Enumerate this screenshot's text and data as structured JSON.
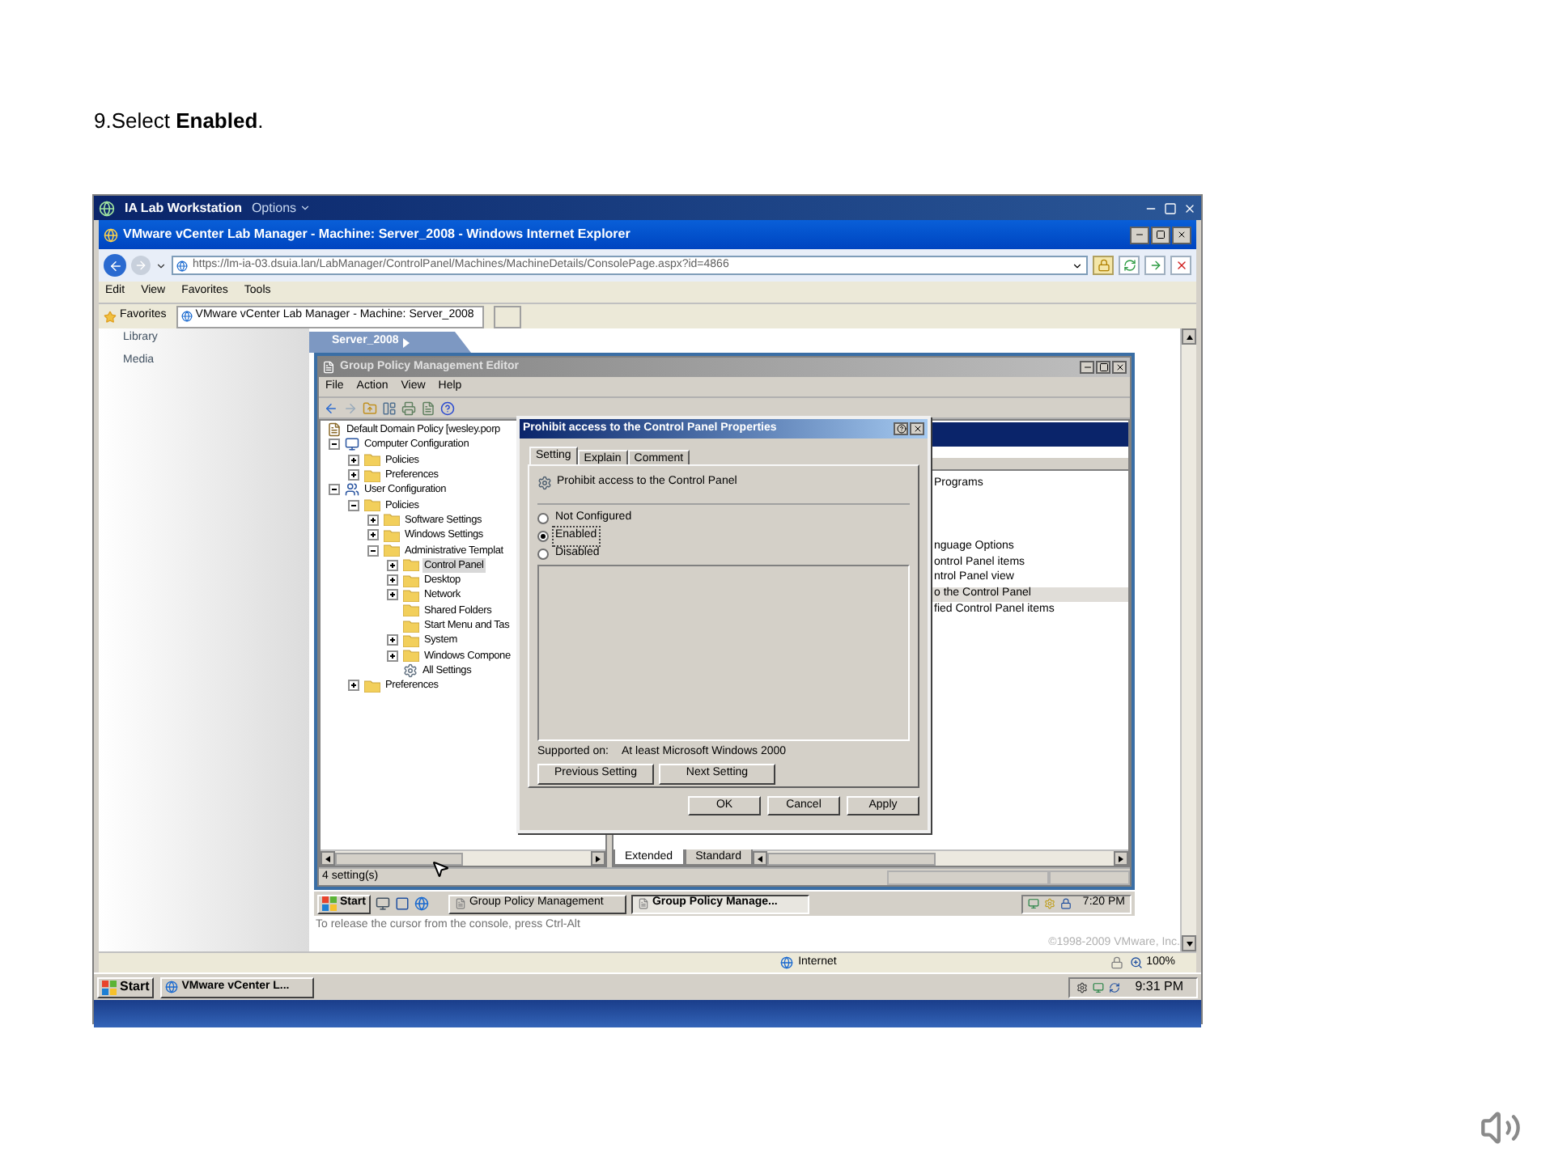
{
  "slide": {
    "instruction": "9.Select **Enabled**."
  },
  "host": {
    "title": "IA Lab Workstation",
    "options": "Options",
    "clock": "9:31 PM",
    "start": "Start",
    "task": "VMware vCenter L..."
  },
  "browser": {
    "title": "VMware vCenter Lab Manager - Machine: Server_2008 - Windows Internet Explorer",
    "address": "https://lm-ia-03.dsuia.lan/LabManager/ControlPanel/Machines/MachineDetails/ConsolePage.aspx?id=4866",
    "menu": [
      "Edit",
      "View",
      "Favorites",
      "Tools"
    ],
    "favorites": "Favorites",
    "tab": "VMware vCenter Lab Manager - Machine: Server_2008",
    "sidebar": [
      "Library",
      "Media"
    ],
    "machine_tab": "Server_2008",
    "console_hint": "To release the cursor from the console, press Ctrl-Alt",
    "copyright": "©1998-2009 VMware, Inc.",
    "status_zone": "Internet",
    "zoom": "100%"
  },
  "editor": {
    "title": "Group Policy Management Editor",
    "menu": [
      "File",
      "Action",
      "View",
      "Help"
    ],
    "tree": [
      {
        "label": "Default Domain Policy [wesley.porp",
        "kind": "policy",
        "selected": false,
        "children": [
          {
            "label": "Computer Configuration",
            "kind": "computer",
            "expanded": true,
            "selected": false,
            "children": [
              {
                "label": "Policies",
                "kind": "folder",
                "expanded": false,
                "selected": false
              },
              {
                "label": "Preferences",
                "kind": "folder",
                "expanded": false,
                "selected": false
              }
            ]
          },
          {
            "label": "User Configuration",
            "kind": "user",
            "expanded": true,
            "selected": false,
            "children": [
              {
                "label": "Policies",
                "kind": "folder",
                "expanded": true,
                "selected": false,
                "children": [
                  {
                    "label": "Software Settings",
                    "kind": "folder",
                    "expanded": false,
                    "selected": false
                  },
                  {
                    "label": "Windows Settings",
                    "kind": "folder",
                    "expanded": false,
                    "selected": false
                  },
                  {
                    "label": "Administrative Templat",
                    "kind": "folder",
                    "expanded": true,
                    "selected": false,
                    "children": [
                      {
                        "label": "Control Panel",
                        "kind": "folder",
                        "expanded": false,
                        "selected": true
                      },
                      {
                        "label": "Desktop",
                        "kind": "folder",
                        "expanded": false,
                        "selected": false
                      },
                      {
                        "label": "Network",
                        "kind": "folder",
                        "expanded": false,
                        "selected": false
                      },
                      {
                        "label": "Shared Folders",
                        "kind": "folder",
                        "selected": false
                      },
                      {
                        "label": "Start Menu and Tas",
                        "kind": "folder",
                        "selected": false
                      },
                      {
                        "label": "System",
                        "kind": "folder",
                        "expanded": false,
                        "selected": false
                      },
                      {
                        "label": "Windows Compone",
                        "kind": "folder",
                        "expanded": false,
                        "selected": false
                      },
                      {
                        "label": "All Settings",
                        "kind": "settings",
                        "selected": false
                      }
                    ]
                  }
                ]
              },
              {
                "label": "Preferences",
                "kind": "folder",
                "expanded": false,
                "selected": false
              }
            ]
          }
        ]
      }
    ],
    "rows": [
      {
        "kind": "text",
        "text": "Programs",
        "selected": false
      },
      {
        "kind": "hidden"
      },
      {
        "kind": "hidden"
      },
      {
        "kind": "hidden"
      },
      {
        "kind": "text",
        "text": "nguage Options",
        "selected": false
      },
      {
        "kind": "text",
        "text": "ontrol Panel items",
        "selected": false
      },
      {
        "kind": "text",
        "text": "ntrol Panel view",
        "selected": false
      },
      {
        "kind": "text",
        "text": "o the Control Panel",
        "selected": true
      },
      {
        "kind": "text",
        "text": "fied Control Panel items",
        "selected": false
      }
    ],
    "view_tabs": [
      {
        "label": "Extended",
        "selected": true
      },
      {
        "label": "Standard",
        "selected": false
      }
    ],
    "status": "4 setting(s)"
  },
  "dialog": {
    "title": "Prohibit access to the Control Panel Properties",
    "tabs": [
      {
        "label": "Setting",
        "selected": true
      },
      {
        "label": "Explain",
        "selected": false
      },
      {
        "label": "Comment",
        "selected": false
      }
    ],
    "setting": "Prohibit access to the Control Panel",
    "options": [
      {
        "label": "Not Configured",
        "selected": false
      },
      {
        "label": "Enabled",
        "selected": true
      },
      {
        "label": "Disabled",
        "selected": false
      }
    ],
    "supported_label": "Supported on:",
    "supported": "At least Microsoft Windows 2000",
    "nav_buttons": [
      "Previous Setting",
      "Next Setting"
    ],
    "buttons": [
      "OK",
      "Cancel",
      "Apply"
    ]
  },
  "guest_taskbar": {
    "start": "Start",
    "tasks": [
      {
        "label": "Group Policy Management",
        "selected": false
      },
      {
        "label": "Group Policy Manage...",
        "selected": true
      }
    ],
    "clock": "7:20 PM"
  }
}
